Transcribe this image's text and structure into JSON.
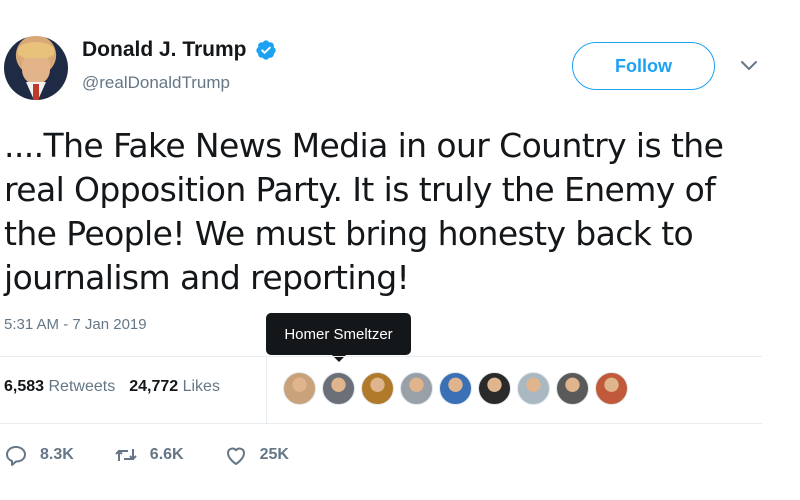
{
  "user": {
    "display_name": "Donald J. Trump",
    "handle": "@realDonaldTrump",
    "verified": true
  },
  "header": {
    "follow_label": "Follow"
  },
  "tweet": {
    "text": "....The Fake News Media in our Country is the real Opposition Party. It is truly the Enemy of the People! We must bring honesty back to journalism and reporting!",
    "timestamp": "5:31 AM - 7 Jan 2019"
  },
  "tooltip": {
    "text": "Homer Smeltzer"
  },
  "stats": {
    "retweets_count": "6,583",
    "retweets_label": "Retweets",
    "likes_count": "24,772",
    "likes_label": "Likes"
  },
  "likers": [
    {
      "name": "liker-avatar-1",
      "color": "#c9a27a"
    },
    {
      "name": "liker-avatar-2",
      "color": "#6b6f78"
    },
    {
      "name": "liker-avatar-3",
      "color": "#b07a2a"
    },
    {
      "name": "liker-avatar-4",
      "color": "#9aa0a8"
    },
    {
      "name": "liker-avatar-5",
      "color": "#3b6fb6"
    },
    {
      "name": "liker-avatar-6",
      "color": "#2a2a2a"
    },
    {
      "name": "liker-avatar-7",
      "color": "#aab8c2"
    },
    {
      "name": "liker-avatar-8",
      "color": "#5a5a5a"
    },
    {
      "name": "liker-avatar-9",
      "color": "#c05a3a"
    }
  ],
  "actions": {
    "replies": "8.3K",
    "retweets": "6.6K",
    "likes": "25K"
  },
  "colors": {
    "accent": "#1da1f2",
    "secondary_text": "#657786",
    "primary_text": "#14171a"
  }
}
